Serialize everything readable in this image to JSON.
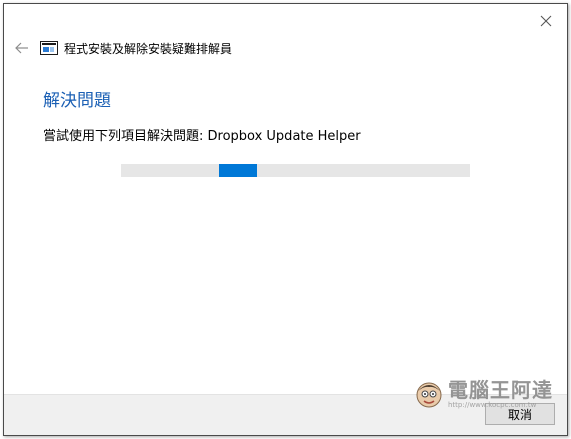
{
  "window": {
    "title": "程式安裝及解除安裝疑難排解員",
    "close_icon": "close-icon",
    "back_icon": "back-arrow-icon",
    "app_icon": "troubleshooter-icon"
  },
  "main": {
    "heading": "解決問題",
    "status_text": "嘗試使用下列項目解決問題: Dropbox Update Helper",
    "progress": {
      "type": "indeterminate",
      "chunk_start_fraction": 0.28,
      "chunk_width_fraction": 0.11
    }
  },
  "footer": {
    "cancel_label": "取消"
  },
  "watermark": {
    "brand": "電腦王阿達",
    "url": "http://www.kocpc.com.tw"
  },
  "colors": {
    "accent": "#0078d7",
    "heading": "#1a5fb4",
    "progress_track": "#e6e6e6",
    "footer_bg": "#f0f0f0"
  }
}
